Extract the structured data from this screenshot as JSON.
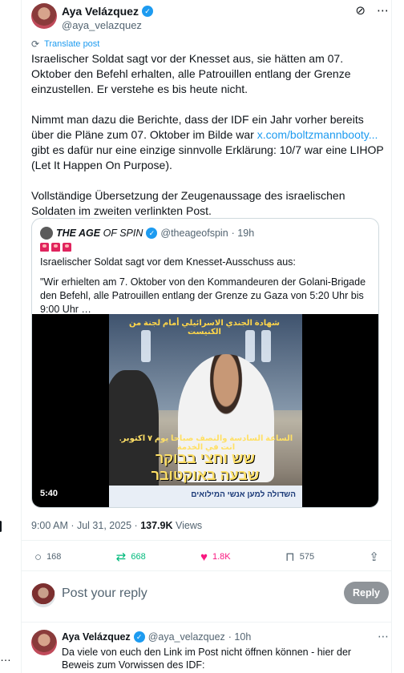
{
  "post": {
    "author_name": "Aya Velázquez",
    "handle": "@aya_velazquez",
    "translate_label": "Translate post",
    "paragraph1": "Israelischer Soldat sagt vor der Knesset aus, sie hätten am 07. Oktober den Befehl erhalten, alle Patrouillen entlang der Grenze einzustellen. Er verstehe es bis heute nicht.",
    "paragraph2_pre": "Nimmt man dazu die Berichte, dass der IDF ein Jahr vorher bereits über die Pläne zum 07. Oktober im Bilde war ",
    "paragraph2_link": "x.com/boltzmannbooty...",
    "paragraph2_post": " gibt es dafür nur eine einzige sinnvolle Erklärung: 10/7 war eine LIHOP (Let It Happen On Purpose).",
    "paragraph3": "Vollständige Übersetzung der Zeugenaussage des israelischen Soldaten im zweiten verlinkten Post.",
    "timestamp": "9:00 AM · Jul 31, 2025 · ",
    "views_count": "137.9K",
    "views_label": " Views"
  },
  "quote": {
    "name_prefix": "THE ",
    "name_bold": "AGE",
    "name_suffix": " OF SPIN",
    "handle": "@theageofspin",
    "time": "· 19h",
    "line1": "Israelischer Soldat sagt vor dem Knesset-Ausschuss aus:",
    "line2": "\"Wir erhielten am 7. Oktober von den Kommandeuren der Golani-Brigade den Befehl, alle Patrouillen entlang der Grenze zu Gaza von 5:20 Uhr bis 9:00 Uhr …",
    "video_duration": "5:40",
    "video_caption_top": "شهادة الجندي الاسرائيلي أمام لجنة من الكنيست",
    "video_caption_ar": "الساعة السادسة والنصف صباحا يوم ٧ اكتوبر. انت في الخدمة",
    "video_caption_he": "שש וחצי בבוקר שבעה באוקטובר",
    "video_bar_text": "השדולה למען אנשי המילואים"
  },
  "actions": {
    "replies": "168",
    "reposts": "668",
    "likes": "1.8K",
    "bookmarks": "575"
  },
  "reply_box": {
    "placeholder": "Post your reply",
    "button": "Reply"
  },
  "reply": {
    "author_name": "Aya Velázquez",
    "handle": "@aya_velazquez",
    "time": "· 10h",
    "text": "Da viele von euch den Link im Post nicht öffnen können - hier der Beweis zum Vorwissen des IDF:"
  },
  "colors": {
    "accent": "#1d9bf0",
    "repost": "#00ba7c",
    "like": "#f91880"
  }
}
